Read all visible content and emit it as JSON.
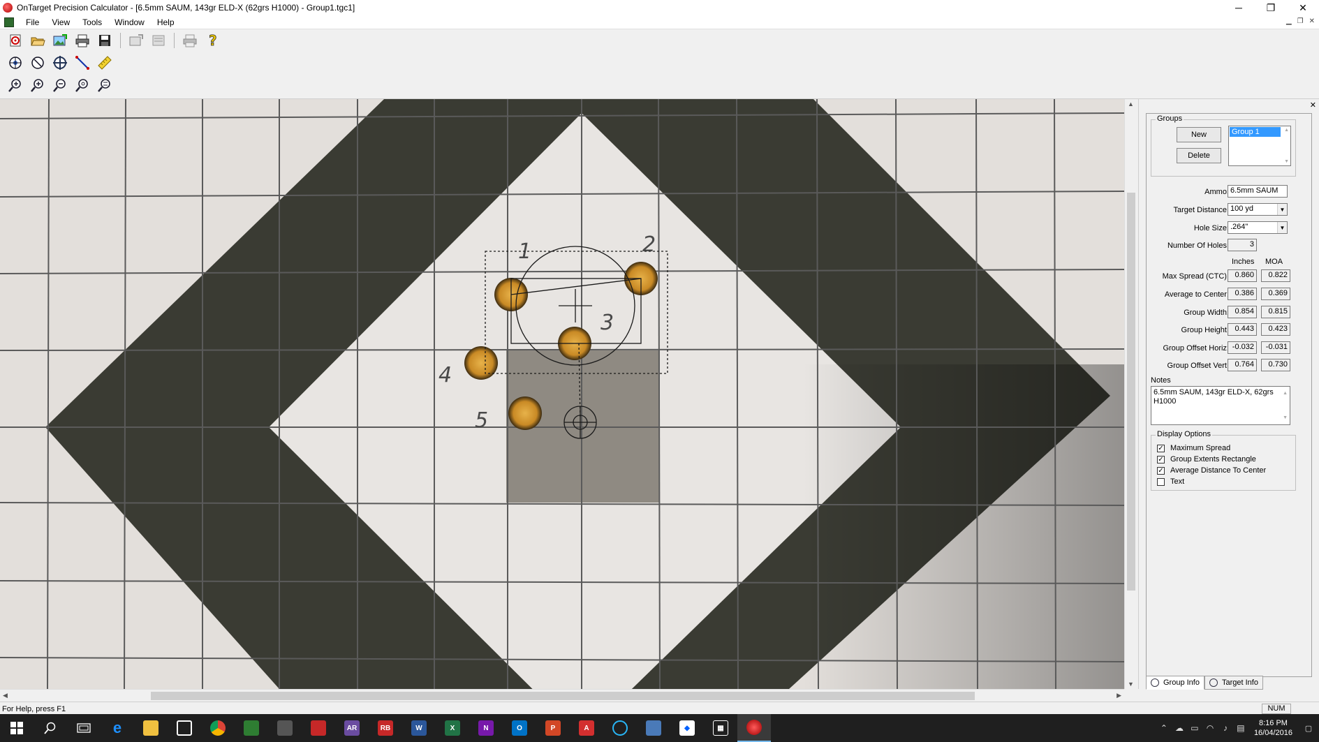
{
  "window": {
    "title": "OnTarget Precision Calculator - [6.5mm SAUM, 143gr ELD-X (62grs H1000) - Group1.tgc1]",
    "min": "─",
    "restore": "❐",
    "close": "✕"
  },
  "menu": [
    "File",
    "View",
    "Tools",
    "Window",
    "Help"
  ],
  "toolbar": {
    "row1": [
      "new-target-icon",
      "open-icon",
      "open-image-icon",
      "print-icon",
      "save-icon",
      "export-icon",
      "report-icon",
      "print-preview-icon",
      "help-icon"
    ],
    "row2": [
      "select-hole-icon",
      "remove-hole-icon",
      "aim-point-icon",
      "measure-line-icon",
      "ruler-icon"
    ],
    "row3": [
      "zoom-in-icon",
      "zoom-fit-icon",
      "zoom-out-icon",
      "zoom-100-icon",
      "zoom-custom-icon"
    ]
  },
  "target": {
    "hole_labels": [
      "1",
      "2",
      "3",
      "4",
      "5"
    ]
  },
  "panel": {
    "groups_legend": "Groups",
    "new_button": "New",
    "delete_button": "Delete",
    "group_list": [
      "Group 1"
    ],
    "ammo_label": "Ammo:",
    "ammo_value": "6.5mm SAUM",
    "distance_label": "Target Distance:",
    "distance_value": "100 yd",
    "hole_size_label": "Hole Size:",
    "hole_size_value": ".264\"",
    "num_holes_label": "Number Of Holes:",
    "num_holes_value": "3",
    "col_inches": "Inches",
    "col_moa": "MOA",
    "stats": [
      {
        "label": "Max Spread (CTC):",
        "inches": "0.860",
        "moa": "0.822"
      },
      {
        "label": "Average to Center:",
        "inches": "0.386",
        "moa": "0.369"
      },
      {
        "label": "Group Width:",
        "inches": "0.854",
        "moa": "0.815"
      },
      {
        "label": "Group Height:",
        "inches": "0.443",
        "moa": "0.423"
      },
      {
        "label": "Group Offset Horiz:",
        "inches": "-0.032",
        "moa": "-0.031"
      },
      {
        "label": "Group Offset Vert:",
        "inches": "0.764",
        "moa": "0.730"
      }
    ],
    "notes_label": "Notes",
    "notes_line1": "6.5mm SAUM, 143gr ELD-X, 62grs",
    "notes_line2": "H1000",
    "display_legend": "Display Options",
    "display_options": [
      {
        "label": "Maximum Spread",
        "checked": true
      },
      {
        "label": "Group Extents Rectangle",
        "checked": true
      },
      {
        "label": "Average Distance To Center",
        "checked": true
      },
      {
        "label": "Text",
        "checked": false
      }
    ],
    "tab_group_info": "Group Info",
    "tab_target_info": "Target Info"
  },
  "status": {
    "help": "For Help, press F1",
    "num": "NUM"
  },
  "taskbar": {
    "time": "8:16 PM",
    "date": "16/04/2016"
  },
  "colors": {
    "dark_diamond": "#3a3b33",
    "paper": "#e3dfdb",
    "grid_line": "#555555",
    "hole": "#d9a23a"
  }
}
